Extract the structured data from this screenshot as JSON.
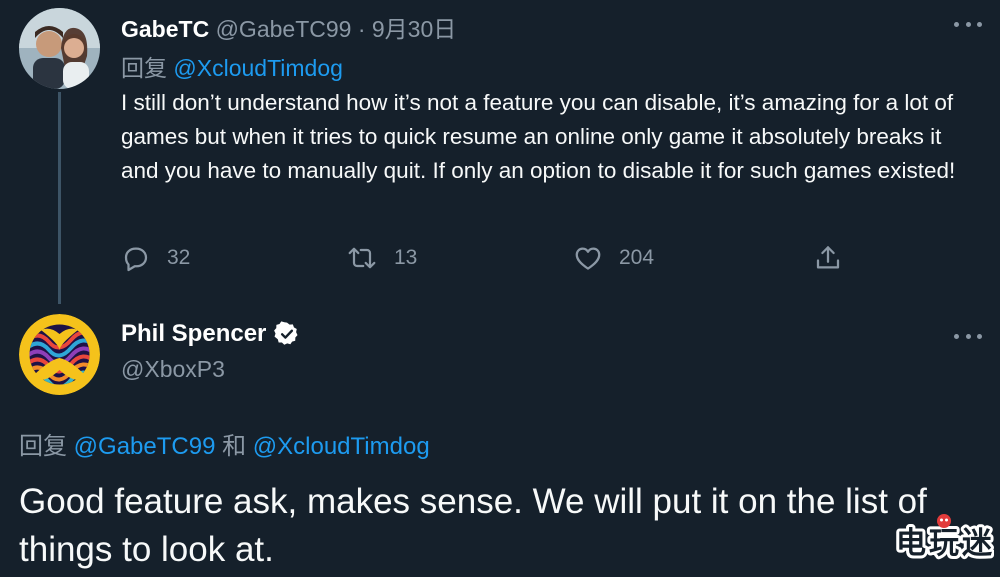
{
  "tweet1": {
    "name": "GabeTC",
    "handle": "@GabeTC99",
    "separator": "·",
    "date": "9月30日",
    "reply_prefix": "回复",
    "reply_to": "@XcloudTimdog",
    "body": "I still don’t understand how it’s not a feature you can disable, it’s amazing for a lot of games but when it tries to quick resume an online only game it absolutely breaks it and you have to manually quit. If only an option to disable it for such games existed!",
    "replies": "32",
    "retweets": "13",
    "likes": "204"
  },
  "tweet2": {
    "name": "Phil Spencer",
    "handle": "@XboxP3",
    "reply_prefix": "回复",
    "reply_to_1": "@GabeTC99",
    "reply_joiner": "和",
    "reply_to_2": "@XcloudTimdog",
    "body": "Good feature ask, makes sense. We will put it on the list of things to look at."
  },
  "watermark": {
    "text": "电玩迷"
  },
  "colors": {
    "background": "#15202b",
    "text": "#f7f9f9",
    "secondary": "#8b98a5",
    "link": "#1d9bf0",
    "thread_line": "#3d5466"
  },
  "icons": [
    "reply-icon",
    "retweet-icon",
    "like-icon",
    "share-icon",
    "more-icon",
    "verified-icon"
  ]
}
